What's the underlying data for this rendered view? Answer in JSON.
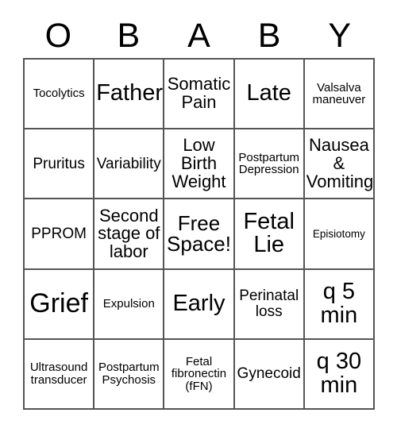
{
  "card": {
    "title_letters": [
      "O",
      "B",
      "A",
      "B",
      "Y"
    ],
    "rows": [
      [
        {
          "text": "Tocolytics",
          "size": "sm"
        },
        {
          "text": "Father",
          "size": "2xl"
        },
        {
          "text": "Somatic Pain",
          "size": "lg"
        },
        {
          "text": "Late",
          "size": "2xl"
        },
        {
          "text": "Valsalva maneuver",
          "size": "sm"
        }
      ],
      [
        {
          "text": "Pruritus",
          "size": "md"
        },
        {
          "text": "Variability",
          "size": "md"
        },
        {
          "text": "Low Birth Weight",
          "size": "lg"
        },
        {
          "text": "Postpartum Depression",
          "size": "sm"
        },
        {
          "text": "Nausea & Vomiting",
          "size": "lg"
        }
      ],
      [
        {
          "text": "PPROM",
          "size": "md"
        },
        {
          "text": "Second stage of labor",
          "size": "lg"
        },
        {
          "text": "Free Space!",
          "size": "xl"
        },
        {
          "text": "Fetal Lie",
          "size": "2xl"
        },
        {
          "text": "Episiotomy",
          "size": "xs"
        }
      ],
      [
        {
          "text": "Grief",
          "size": "3xl"
        },
        {
          "text": "Expulsion",
          "size": "sm"
        },
        {
          "text": "Early",
          "size": "2xl"
        },
        {
          "text": "Perinatal loss",
          "size": "md"
        },
        {
          "text": "q 5 min",
          "size": "2xl"
        }
      ],
      [
        {
          "text": "Ultrasound transducer",
          "size": "sm"
        },
        {
          "text": "Postpartum Psychosis",
          "size": "sm"
        },
        {
          "text": "Fetal fibronectin (fFN)",
          "size": "sm"
        },
        {
          "text": "Gynecoid",
          "size": "md"
        },
        {
          "text": "q 30 min",
          "size": "2xl"
        }
      ]
    ],
    "colors": {
      "background": "#ffffff",
      "text": "#000000",
      "grid_line": "#555555"
    }
  }
}
